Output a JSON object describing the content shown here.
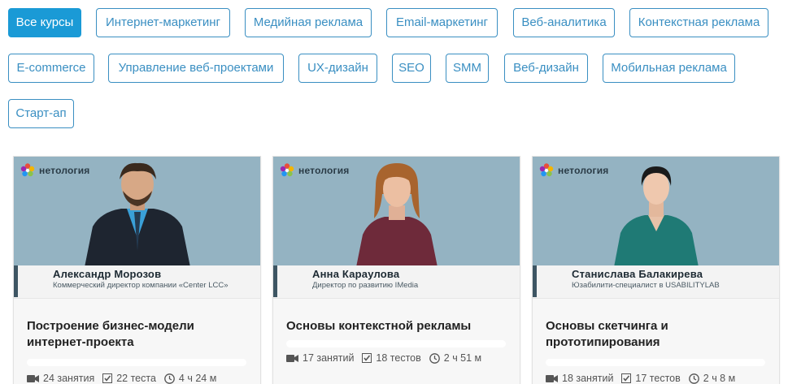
{
  "filters": [
    {
      "label": "Все курсы",
      "active": true
    },
    {
      "label": "Интернет-маркетинг"
    },
    {
      "label": "Медийная реклама"
    },
    {
      "label": "Email-маркетинг"
    },
    {
      "label": "Веб-аналитика"
    },
    {
      "label": "Контекстная реклама"
    },
    {
      "label": "E-commerce"
    },
    {
      "label": "Управление веб-проектами"
    },
    {
      "label": "UX-дизайн"
    },
    {
      "label": "SEO"
    },
    {
      "label": "SMM"
    },
    {
      "label": "Веб-дизайн"
    },
    {
      "label": "Мобильная реклама"
    },
    {
      "label": "Старт-ап"
    }
  ],
  "logo_text": "нетология",
  "cards": [
    {
      "name": "Александр Морозов",
      "role": "Коммерческий директор компании «Center LCC»",
      "title": "Построение бизнес-модели интернет-проекта",
      "lessons": "24 занятия",
      "tests": "22 теста",
      "duration": "4 ч 24 м"
    },
    {
      "name": "Анна Караулова",
      "role": "Директор по развитию IMedia",
      "title": "Основы контекстной рекламы",
      "lessons": "17 занятий",
      "tests": "18 тестов",
      "duration": "2 ч 51 м"
    },
    {
      "name": "Станислава Балакирева",
      "role": "Юзабилити-специалист в USABILITYLAB",
      "title": "Основы скетчинга и прототипирования",
      "lessons": "18 занятий",
      "tests": "17 тестов",
      "duration": "2 ч 8 м"
    }
  ],
  "colors": {
    "accent": "#1a9ad6",
    "border": "#3a8fc2",
    "photo_bg": "#94b3c2"
  }
}
